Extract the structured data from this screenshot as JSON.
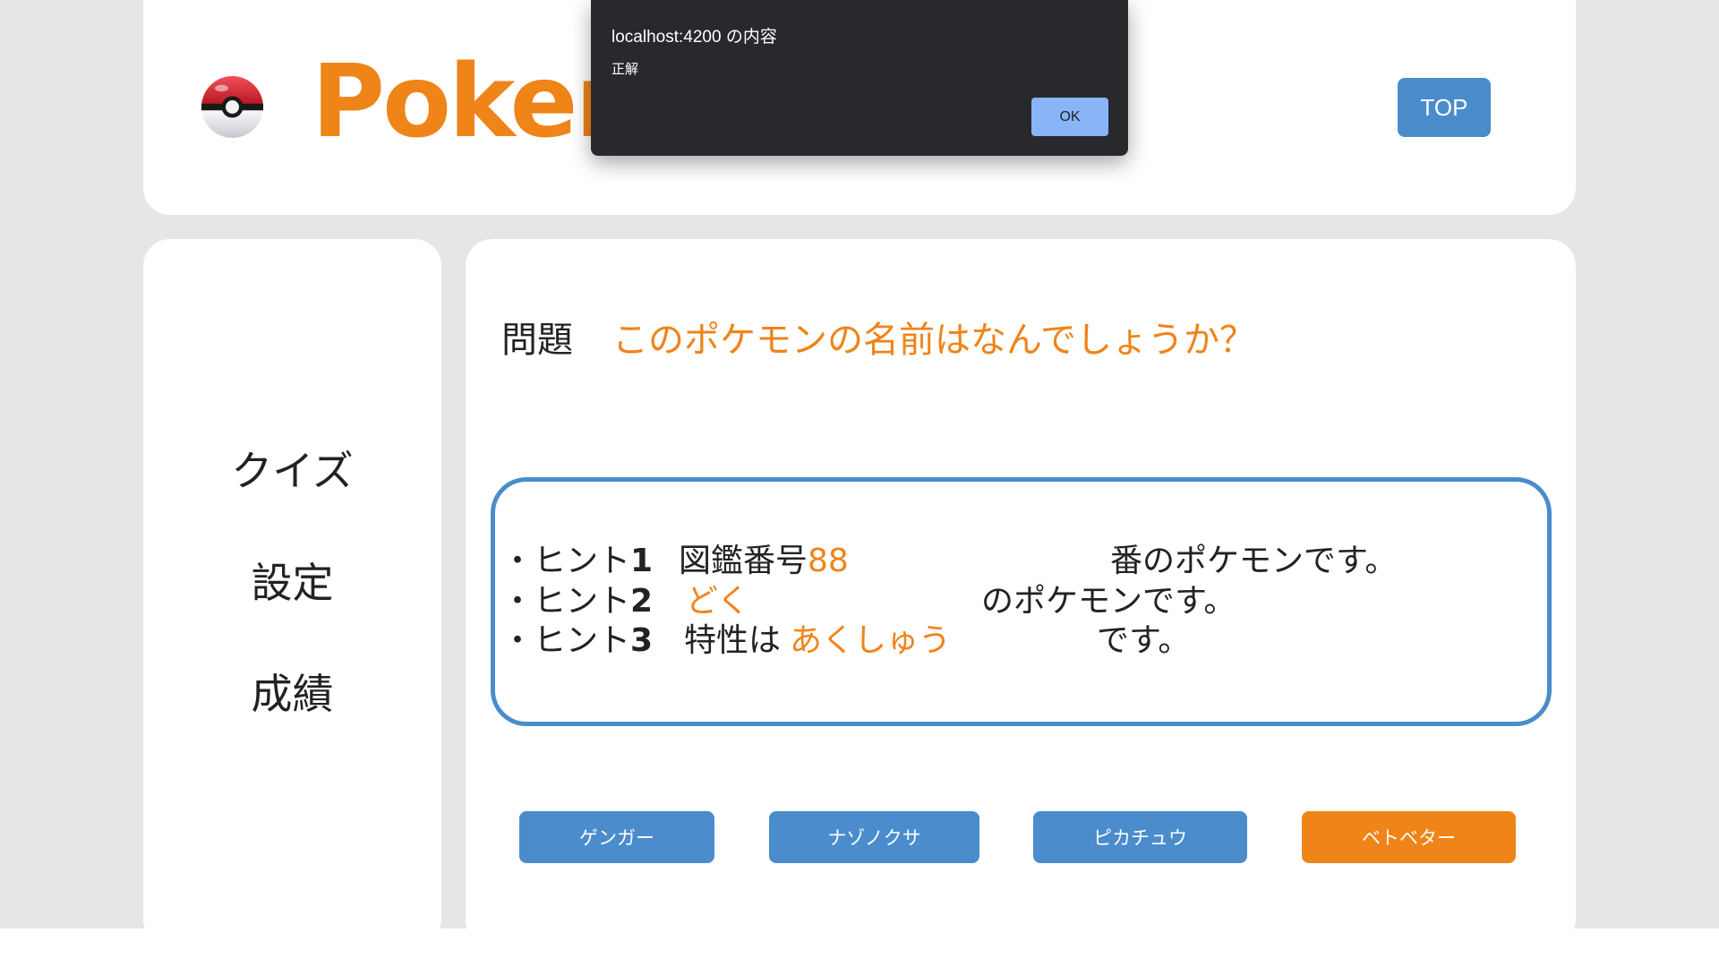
{
  "header": {
    "logo_text": "Pokem",
    "top_button": "TOP"
  },
  "sidebar": {
    "items": [
      {
        "label": "クイズ"
      },
      {
        "label": "設定"
      },
      {
        "label": "成績"
      }
    ]
  },
  "question": {
    "label": "問題",
    "text": "このポケモンの名前はなんでしょうか？"
  },
  "hints": {
    "hint1": {
      "prefix": "・ヒント",
      "number": "1",
      "lead": "図鑑番号",
      "value": "88",
      "suffix": "番のポケモンです。"
    },
    "hint2": {
      "prefix": "・ヒント",
      "number": "2",
      "value": "どく",
      "suffix": "のポケモンです。"
    },
    "hint3": {
      "prefix": "・ヒント",
      "number": "3",
      "lead": "特性は",
      "value": "あくしゅう",
      "suffix": "です。"
    }
  },
  "answers": [
    {
      "label": "ゲンガー",
      "selected": false
    },
    {
      "label": "ナゾノクサ",
      "selected": false
    },
    {
      "label": "ピカチュウ",
      "selected": false
    },
    {
      "label": "ベトベター",
      "selected": true
    }
  ],
  "dialog": {
    "title": "localhost:4200 の内容",
    "message": "正解",
    "ok_label": "OK"
  },
  "colors": {
    "accent_orange": "#ef8419",
    "accent_blue": "#4a8ccc",
    "background": "#e6e6e6",
    "dialog_bg": "#28292c",
    "dialog_button": "#8ab4f8"
  }
}
